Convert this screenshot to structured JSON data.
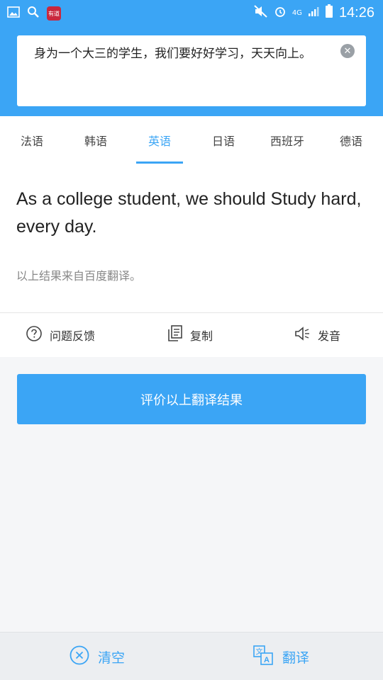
{
  "status_bar": {
    "time": "14:26",
    "app_badge": "有道",
    "network": "4G"
  },
  "input": {
    "text": "身为一个大三的学生，我们要好好学习，天天向上。"
  },
  "tabs": [
    {
      "label": "法语",
      "active": false
    },
    {
      "label": "韩语",
      "active": false
    },
    {
      "label": "英语",
      "active": true
    },
    {
      "label": "日语",
      "active": false
    },
    {
      "label": "西班牙",
      "active": false
    },
    {
      "label": "德语",
      "active": false
    }
  ],
  "result": {
    "translation": "As a college student, we should Study hard, every day.",
    "source_note": "以上结果来自百度翻译。"
  },
  "actions": {
    "feedback": "问题反馈",
    "copy": "复制",
    "pronounce": "发音"
  },
  "evaluate_button": "评价以上翻译结果",
  "bottom_bar": {
    "clear": "清空",
    "translate": "翻译"
  },
  "colors": {
    "accent": "#3ba5f5"
  }
}
